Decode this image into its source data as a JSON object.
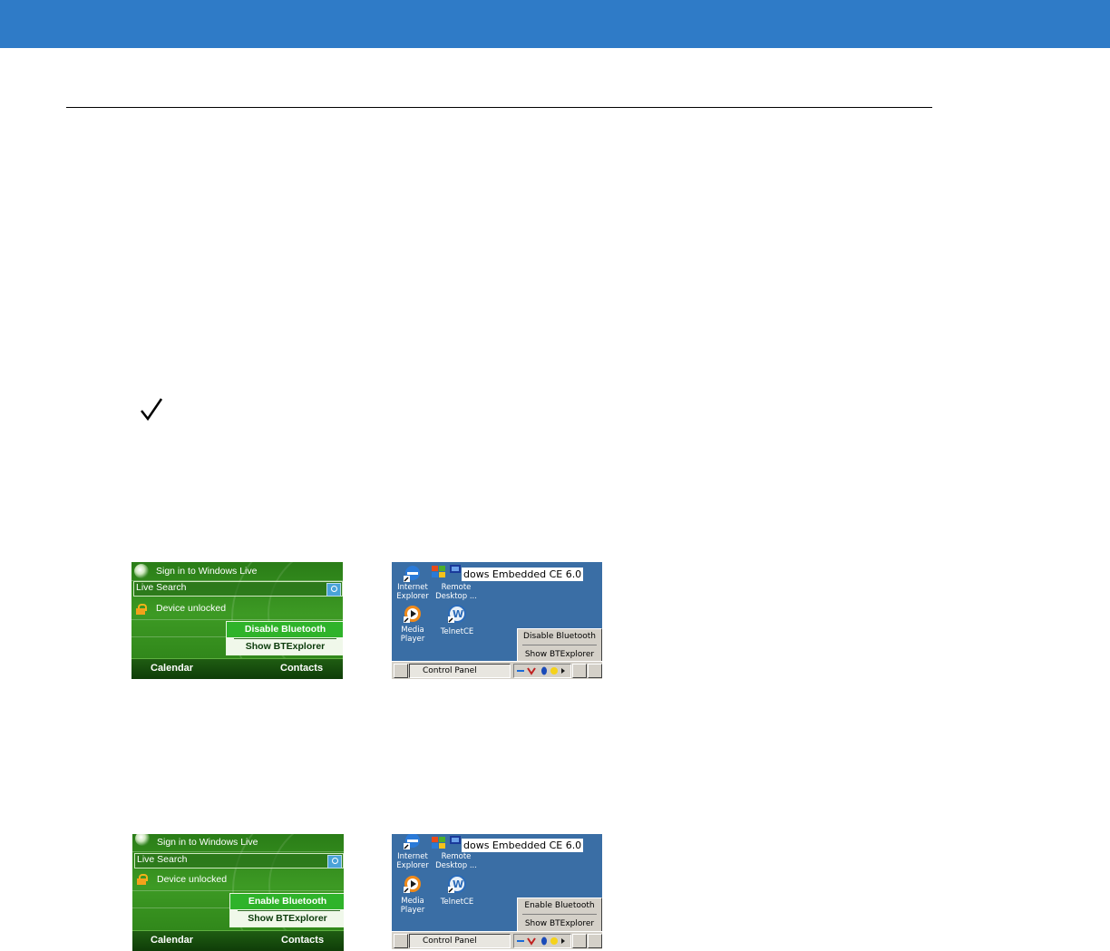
{
  "figures": [
    {
      "wm": {
        "sign_in": "Sign in to Windows Live",
        "search_label": "Live Search",
        "status": "Device unlocked",
        "menu_item_1": "Disable Bluetooth",
        "menu_item_2": "Show BTExplorer",
        "soft_left": "Calendar",
        "soft_right": "Contacts"
      },
      "ce": {
        "title": "dows Embedded CE 6.0",
        "icon_1_label": "Internet Explorer",
        "icon_2_label": "Remote Desktop ...",
        "icon_3_label": "Media Player",
        "icon_4_label": "TelnetCE",
        "menu_item_1": "Disable Bluetooth",
        "menu_item_2": "Show BTExplorer",
        "taskbar_item": "Control Panel"
      }
    },
    {
      "wm": {
        "sign_in": "Sign in to Windows Live",
        "search_label": "Live Search",
        "status": "Device unlocked",
        "menu_item_1": "Enable Bluetooth",
        "menu_item_2": "Show BTExplorer",
        "soft_left": "Calendar",
        "soft_right": "Contacts"
      },
      "ce": {
        "title": "dows Embedded CE 6.0",
        "icon_1_label": "Internet Explorer",
        "icon_2_label": "Remote Desktop ...",
        "icon_3_label": "Media Player",
        "icon_4_label": "TelnetCE",
        "menu_item_1": "Enable Bluetooth",
        "menu_item_2": "Show BTExplorer",
        "taskbar_item": "Control Panel"
      }
    }
  ]
}
